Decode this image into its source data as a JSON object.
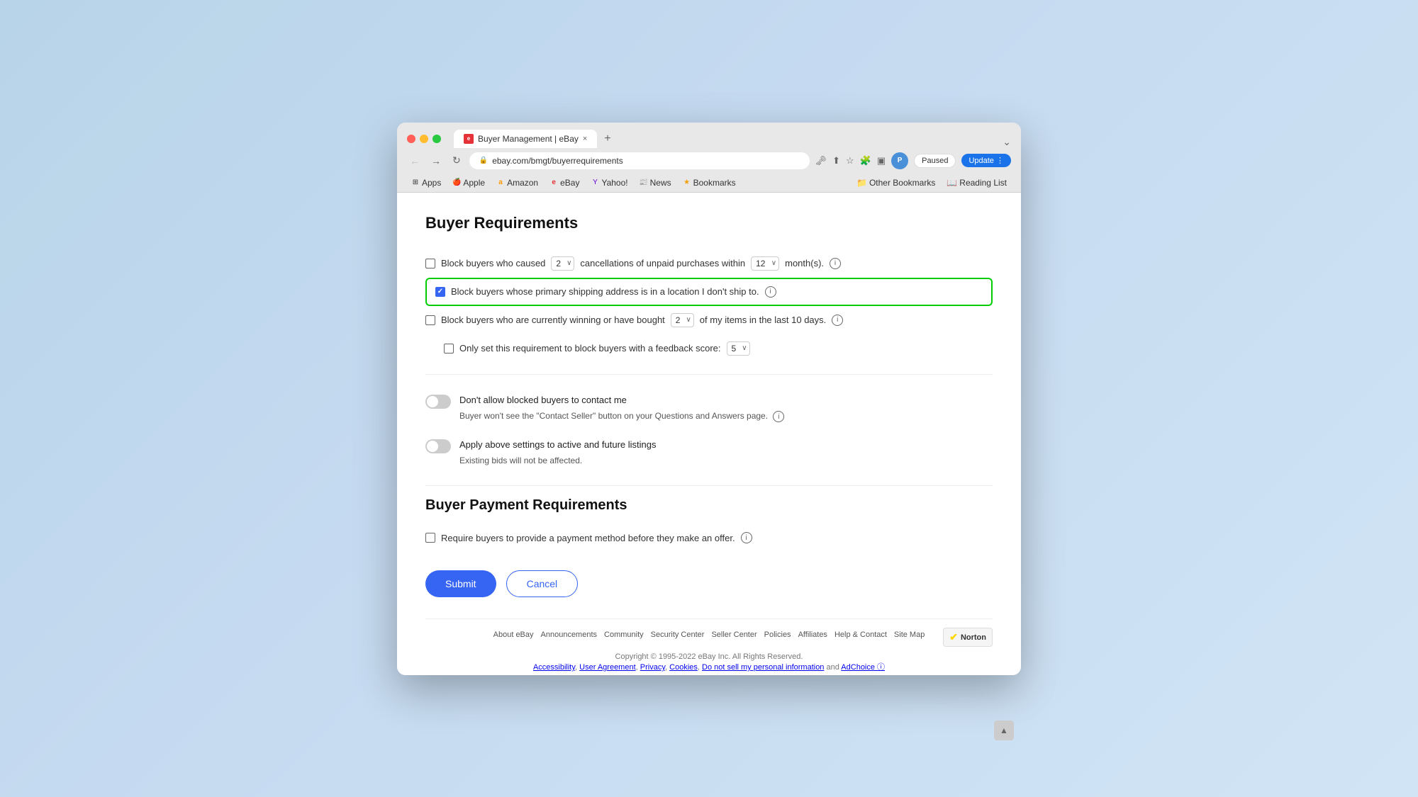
{
  "browser": {
    "tab_title": "Buyer Management | eBay",
    "tab_close": "×",
    "tab_new": "+",
    "url": "ebay.com/bmgt/buyerrequirements",
    "paused_label": "Paused",
    "update_label": "Update",
    "collapse_icon": "⌄"
  },
  "bookmarks": {
    "items": [
      {
        "id": "apps",
        "label": "Apps",
        "icon": "⊞"
      },
      {
        "id": "apple",
        "label": "Apple",
        "icon": ""
      },
      {
        "id": "amazon",
        "label": "Amazon",
        "icon": "a"
      },
      {
        "id": "ebay",
        "label": "eBay",
        "icon": "e"
      },
      {
        "id": "yahoo",
        "label": "Yahoo!",
        "icon": "Y"
      },
      {
        "id": "news",
        "label": "News",
        "icon": "📰"
      },
      {
        "id": "bookmarks",
        "label": "Bookmarks",
        "icon": "★"
      }
    ],
    "other_bookmarks": "Other Bookmarks",
    "reading_list": "Reading List"
  },
  "page": {
    "buyer_requirements_title": "Buyer Requirements",
    "row1_text1": "Block buyers who caused",
    "row1_dropdown1": "2",
    "row1_text2": "cancellations of unpaid purchases within",
    "row1_dropdown2": "12",
    "row1_text3": "month(s).",
    "row2_text": "Block buyers whose primary shipping address is in a location I don't ship to.",
    "row3_text1": "Block buyers who are currently winning or have bought",
    "row3_dropdown": "2",
    "row3_text2": "of my items in the last 10 days.",
    "row4_text1": "Only set this requirement to block buyers with a feedback score:",
    "row4_dropdown": "5",
    "toggle1_label": "Don't allow blocked buyers to contact me",
    "toggle1_desc": "Buyer won't see the \"Contact Seller\" button on your Questions and Answers page.",
    "toggle2_label": "Apply above settings to active and future listings",
    "toggle2_desc": "Existing bids will not be affected.",
    "payment_section_title": "Buyer Payment Requirements",
    "payment_row_text": "Require buyers to provide a payment method before they make an offer.",
    "submit_label": "Submit",
    "cancel_label": "Cancel",
    "footer_links": [
      "About eBay",
      "Announcements",
      "Community",
      "Security Center",
      "Seller Center",
      "Policies",
      "Affiliates",
      "Help & Contact",
      "Site Map"
    ],
    "copyright": "Copyright © 1995-2022 eBay Inc. All Rights Reserved.",
    "footer_legal": "Accessibility, User Agreement, Privacy, Cookies, Do not sell my personal information and AdChoice ⓘ",
    "norton_label": "Norton"
  }
}
